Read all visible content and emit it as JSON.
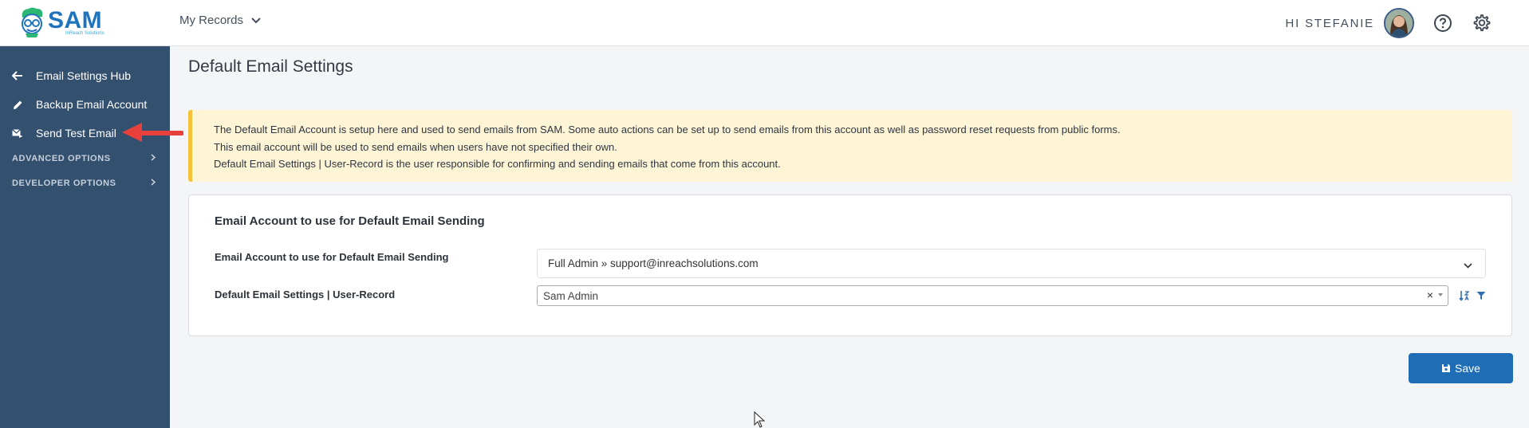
{
  "header": {
    "logo_text": "SAM",
    "logo_subtext": "InReach Solutions",
    "records_menu_label": "My Records",
    "greeting": "HI STEFANIE"
  },
  "sidebar": {
    "items": [
      {
        "label": "Email Settings Hub",
        "icon": "arrow-left-icon"
      },
      {
        "label": "Backup Email Account",
        "icon": "pencil-icon"
      },
      {
        "label": "Send Test Email",
        "icon": "mail-send-icon"
      }
    ],
    "sections": [
      {
        "label": "ADVANCED OPTIONS"
      },
      {
        "label": "DEVELOPER OPTIONS"
      }
    ]
  },
  "main": {
    "title": "Default Email Settings",
    "alert_lines": [
      "The Default Email Account is setup here and used to send emails from SAM. Some auto actions can be set up to send emails from this account as well as password reset requests from public forms.",
      "This email account will be used to send emails when users have not specified their own.",
      "Default Email Settings | User-Record is the user responsible for confirming and sending emails that come from this account."
    ],
    "card": {
      "title": "Email Account to use for Default Email Sending",
      "fields": [
        {
          "label": "Email Account to use for Default Email Sending",
          "value": "Full Admin » support@inreachsolutions.com"
        },
        {
          "label": "Default Email Settings | User-Record",
          "value": "Sam Admin"
        }
      ]
    },
    "save_label": "Save"
  },
  "colors": {
    "sidebar_bg": "#34506f",
    "primary": "#1f6db5",
    "alert_bg": "#fef4d6",
    "alert_border": "#f6c23c",
    "annotation_arrow": "#e8403a"
  }
}
